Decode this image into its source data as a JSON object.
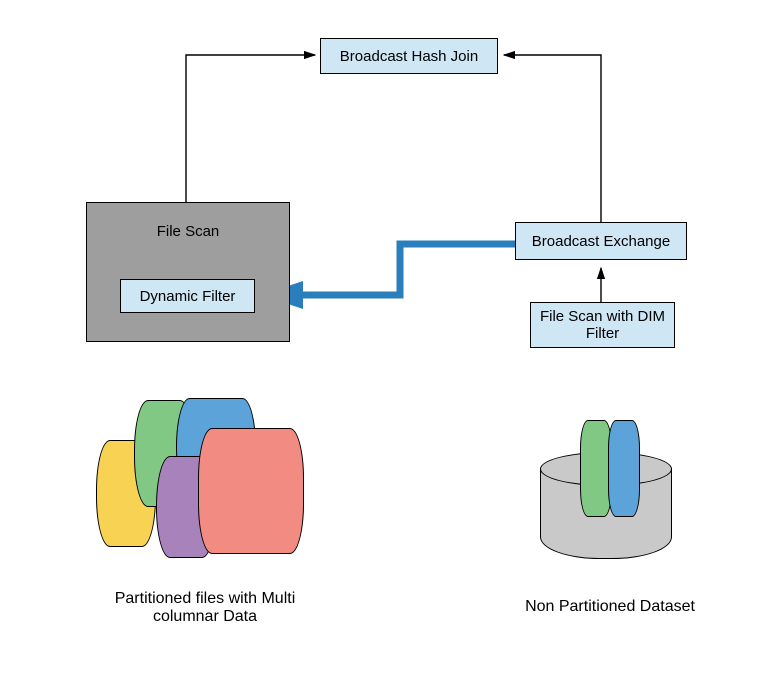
{
  "nodes": {
    "broadcast_hash_join": "Broadcast Hash Join",
    "file_scan": "File Scan",
    "dynamic_filter": "Dynamic Filter",
    "broadcast_exchange": "Broadcast Exchange",
    "file_scan_dim": "File Scan with DIM Filter"
  },
  "captions": {
    "left": "Partitioned files with Multi columnar Data",
    "right": "Non Partitioned Dataset"
  },
  "colors": {
    "box_fill": "#cfe6f5",
    "grey_fill": "#9e9e9e",
    "highlight_edge": "#2a7ebc"
  },
  "edges": [
    {
      "from": "file_scan",
      "to": "broadcast_hash_join",
      "style": "thin"
    },
    {
      "from": "broadcast_exchange",
      "to": "broadcast_hash_join",
      "style": "thin"
    },
    {
      "from": "file_scan_dim",
      "to": "broadcast_exchange",
      "style": "thin"
    },
    {
      "from": "broadcast_exchange",
      "to": "dynamic_filter",
      "style": "thick"
    }
  ]
}
